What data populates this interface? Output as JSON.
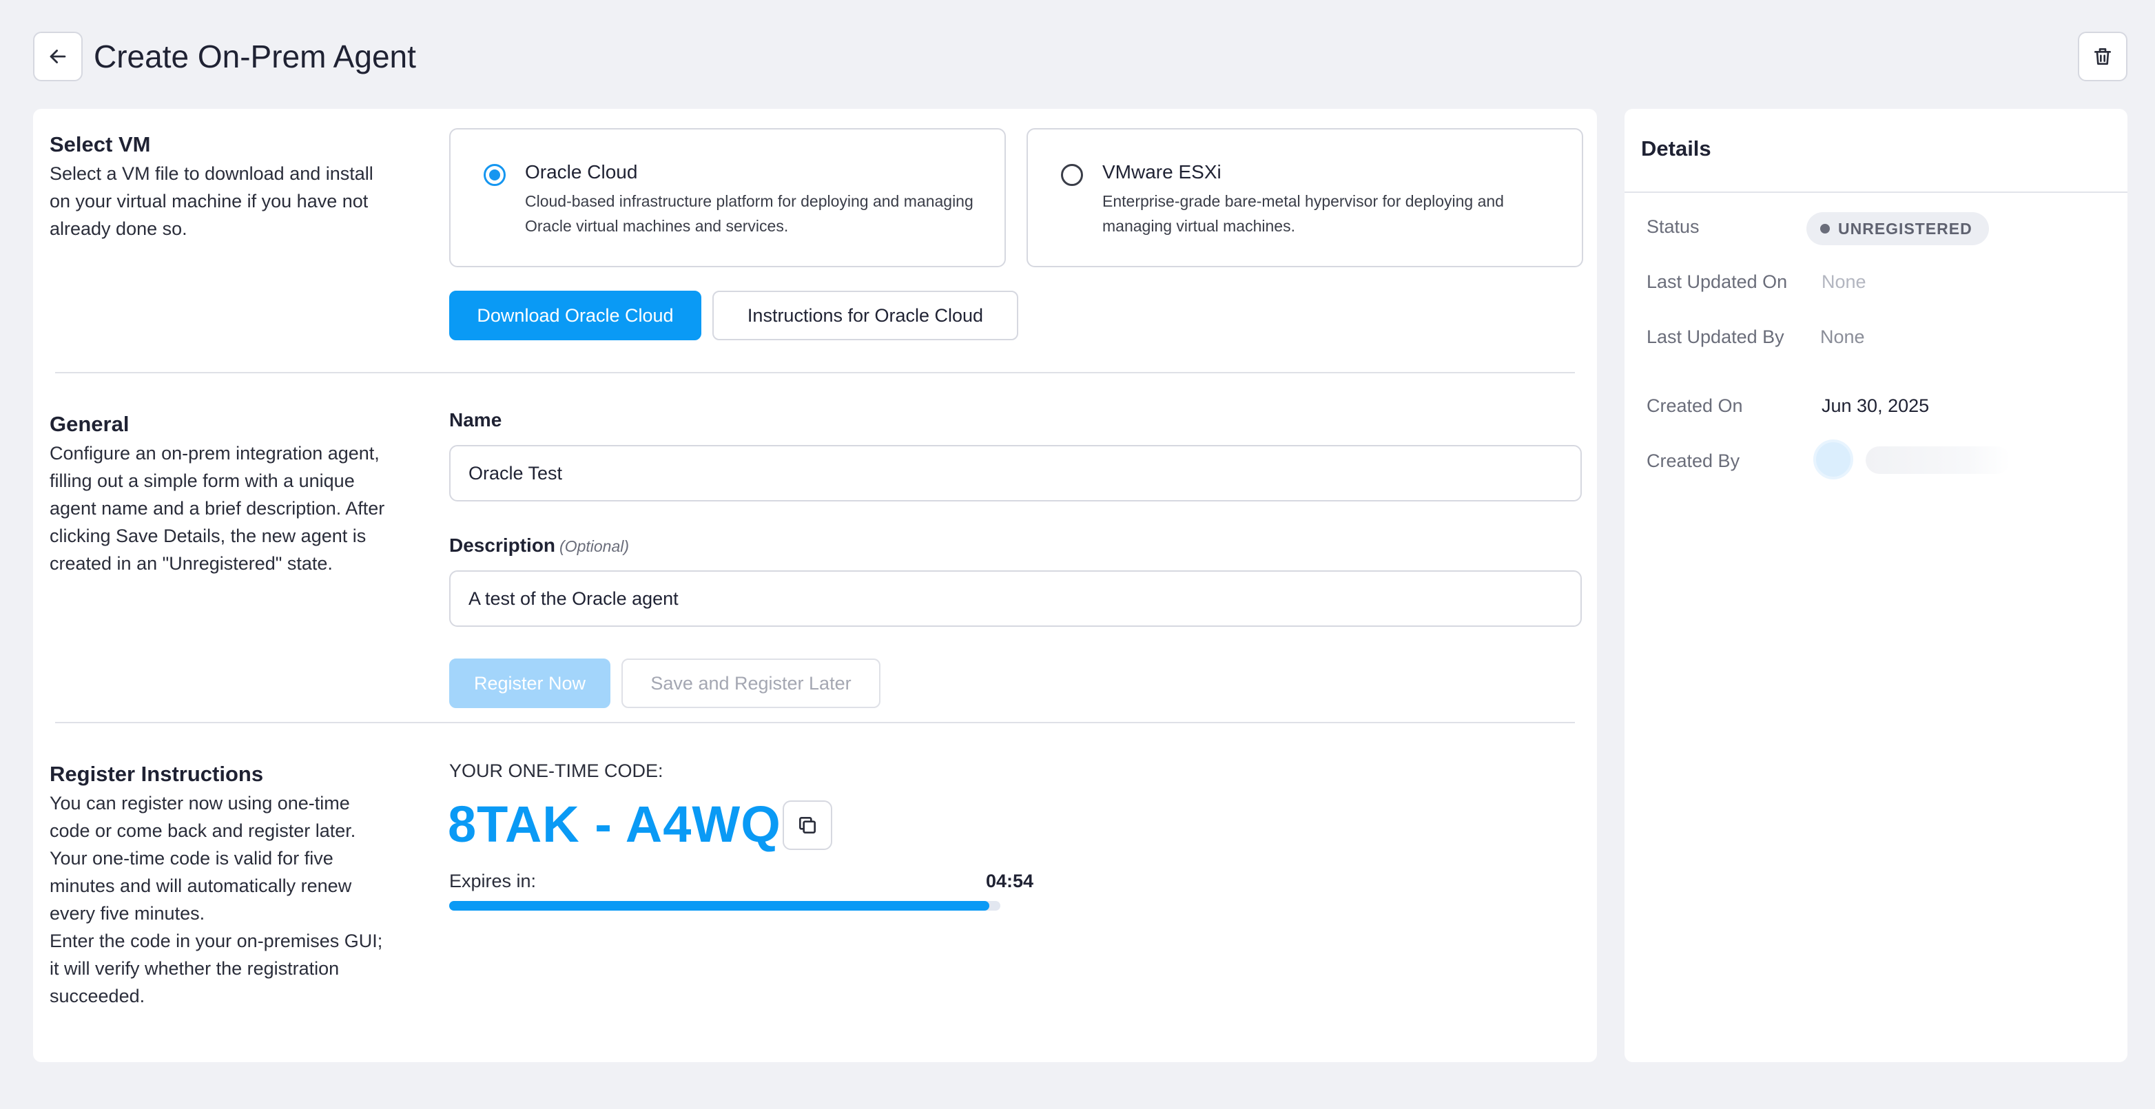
{
  "header": {
    "title": "Create On-Prem Agent",
    "back_icon": "arrow-left-icon",
    "delete_icon": "trash-icon"
  },
  "select_vm": {
    "title": "Select VM",
    "description": "Select a VM file to download and install on your virtual machine if you have not already done so.",
    "options": [
      {
        "name": "Oracle Cloud",
        "description": "Cloud-based infrastructure platform for deploying and managing Oracle virtual machines and services.",
        "selected": true
      },
      {
        "name": "VMware ESXi",
        "description": "Enterprise-grade bare-metal hypervisor for deploying and managing virtual machines.",
        "selected": false
      }
    ],
    "download_label": "Download Oracle Cloud",
    "instructions_label": "Instructions for Oracle Cloud"
  },
  "general": {
    "title": "General",
    "description": "Configure an on-prem integration agent, filling out a simple form with a unique agent name and a brief description. After clicking Save Details, the new agent is created in an \"Unregistered\" state.",
    "name_label": "Name",
    "name_value": "Oracle Test",
    "description_label": "Description",
    "description_optional": "(Optional)",
    "description_value": "A test of the Oracle agent",
    "register_now_label": "Register Now",
    "save_later_label": "Save and Register Later"
  },
  "register": {
    "title": "Register Instructions",
    "description_1": "You can register now using one-time code or come back and register later. Your one-time code is valid for five minutes and will automatically renew every five minutes.",
    "description_2": "Enter the code in your on-premises GUI; it will verify whether the registration succeeded.",
    "code_label": "YOUR ONE-TIME CODE:",
    "code": "8TAK - A4WQ",
    "copy_icon": "copy-icon",
    "expires_label": "Expires in:",
    "expires_time": "04:54",
    "expires_progress": 0.98
  },
  "details": {
    "title": "Details",
    "status_label": "Status",
    "status_value": "UNREGISTERED",
    "last_updated_on_label": "Last Updated On",
    "last_updated_on_value": "None",
    "last_updated_by_label": "Last Updated By",
    "last_updated_by_value": "None",
    "created_on_label": "Created On",
    "created_on_value": "Jun 30, 2025",
    "created_by_label": "Created By"
  },
  "colors": {
    "accent": "#0a9af5",
    "background": "#f0f1f5",
    "border": "#d6d8e0"
  }
}
